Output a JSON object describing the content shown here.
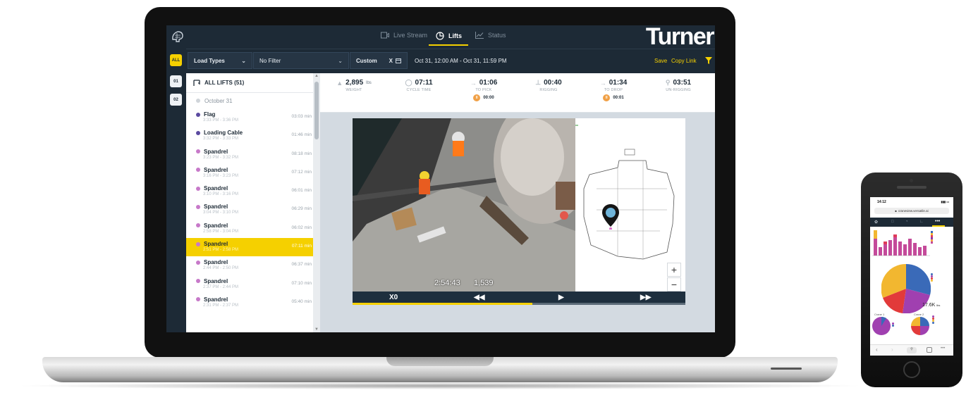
{
  "nav": {
    "tabs": [
      {
        "label": "Live Stream",
        "icon": "video-camera-icon"
      },
      {
        "label": "Lifts",
        "icon": "pie-chart-icon"
      },
      {
        "label": "Status",
        "icon": "line-chart-icon"
      }
    ],
    "active_tab": "Lifts",
    "brand": "Turner"
  },
  "filters": {
    "load_types": "Load Types",
    "filter": "No Filter",
    "range_mode": "Custom",
    "clear": "X",
    "date_range": "Oct 31, 12:00 AM - Oct 31, 11:59 PM",
    "save": "Save",
    "copy_link": "Copy Link"
  },
  "cranes": [
    "ALL",
    "01",
    "02"
  ],
  "lift_list": {
    "header": "ALL LIFTS (51)",
    "date": "October 31",
    "items": [
      {
        "name": "Flag",
        "time": "3:33 PM - 3:36 PM",
        "duration": "03:03 min",
        "color": "#5b4aa0",
        "selected": false
      },
      {
        "name": "Loading Cable",
        "time": "3:32 PM - 3:33 PM",
        "duration": "01:46 min",
        "color": "#5b4aa0",
        "selected": false
      },
      {
        "name": "Spandrel",
        "time": "3:23 PM - 3:32 PM",
        "duration": "08:18 min",
        "color": "#c779c9",
        "selected": false
      },
      {
        "name": "Spandrel",
        "time": "3:16 PM - 3:23 PM",
        "duration": "07:12 min",
        "color": "#c779c9",
        "selected": false
      },
      {
        "name": "Spandrel",
        "time": "3:10 PM - 3:16 PM",
        "duration": "06:01 min",
        "color": "#c779c9",
        "selected": false
      },
      {
        "name": "Spandrel",
        "time": "3:04 PM - 3:10 PM",
        "duration": "06:29 min",
        "color": "#c779c9",
        "selected": false
      },
      {
        "name": "Spandrel",
        "time": "2:58 PM - 3:04 PM",
        "duration": "06:02 min",
        "color": "#c779c9",
        "selected": false
      },
      {
        "name": "Spandrel",
        "time": "2:51 PM - 2:58 PM",
        "duration": "07:11 min",
        "color": "#c779c9",
        "selected": true
      },
      {
        "name": "Spandrel",
        "time": "2:44 PM - 2:50 PM",
        "duration": "06:37 min",
        "color": "#c779c9",
        "selected": false
      },
      {
        "name": "Spandrel",
        "time": "2:37 PM - 2:44 PM",
        "duration": "07:10 min",
        "color": "#c779c9",
        "selected": false
      },
      {
        "name": "Spandrel",
        "time": "2:31 PM - 2:37 PM",
        "duration": "05:40 min",
        "color": "#c779c9",
        "selected": false
      }
    ]
  },
  "stats": {
    "weight": {
      "value": "2,895",
      "unit": "lbs",
      "label": "WEIGHT"
    },
    "cycle_time": {
      "value": "07:11",
      "label": "CYCLE TIME"
    },
    "to_pick": {
      "value": "01:06",
      "label": "TO PICK",
      "idle": "00:00"
    },
    "rigging": {
      "value": "00:40",
      "label": "RIGGING"
    },
    "to_drop": {
      "value": "01:34",
      "label": "TO DROP",
      "idle": "00:01"
    },
    "unrigging": {
      "value": "03:51",
      "label": "UN-RIGGING"
    }
  },
  "video": {
    "timestamp": "2:54:43",
    "height": "1,539",
    "speed": "X0",
    "progress": 0.54
  },
  "phone": {
    "time": "14:12",
    "url": "craneview.versatile.ai",
    "total": "17.6K",
    "total_unit": "lbs",
    "crane_labels": [
      "Crane 1",
      "Crane 2"
    ]
  },
  "colors": {
    "accent": "#f5d000",
    "nav_bg": "#1d2a36",
    "lift_purple": "#5b4aa0",
    "lift_pink": "#c779c9",
    "idle_orange": "#f0a046"
  }
}
